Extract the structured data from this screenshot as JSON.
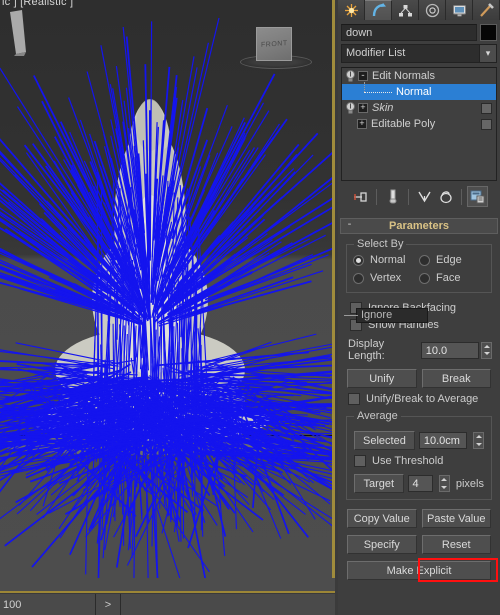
{
  "viewport": {
    "label": "ic ] [Realistic ]",
    "viewcube_face": "FRONT",
    "normals_color": "#1414ee",
    "mesh_color": "#dcdcd2",
    "background_color": "#454545",
    "active_border_color": "#a08c3c"
  },
  "timeline": {
    "frame_value": "100",
    "next_button": ">"
  },
  "command_panel": {
    "tabs": [
      {
        "name": "create-tab",
        "icon": "star-icon",
        "active": false
      },
      {
        "name": "modify-tab",
        "icon": "bent-arrow-icon",
        "active": true
      },
      {
        "name": "hierarchy-tab",
        "icon": "hierarchy-icon",
        "active": false
      },
      {
        "name": "motion-tab",
        "icon": "wheel-icon",
        "active": false
      },
      {
        "name": "display-tab",
        "icon": "monitor-icon",
        "active": false
      },
      {
        "name": "utilities-tab",
        "icon": "hammer-icon",
        "active": false
      }
    ],
    "object_name": "down",
    "object_color": "#060606",
    "modifier_list_label": "Modifier List",
    "stack": [
      {
        "label": "Edit Normals",
        "bulb": true,
        "expand": "-",
        "selected": false,
        "italic": false,
        "checkbox": false,
        "indent": false
      },
      {
        "label": "Normal",
        "bulb": false,
        "expand": "",
        "selected": true,
        "italic": false,
        "checkbox": false,
        "indent": true
      },
      {
        "label": "Skin",
        "bulb": true,
        "expand": "+",
        "selected": false,
        "italic": true,
        "checkbox": true,
        "indent": false
      },
      {
        "label": "Editable Poly",
        "bulb": false,
        "expand": "+",
        "selected": false,
        "italic": false,
        "checkbox": true,
        "indent": false
      }
    ],
    "stack_toolbar": [
      {
        "name": "pin-stack-icon",
        "framed": false
      },
      {
        "name": "show-end-result-icon",
        "framed": false
      },
      {
        "name": "make-unique-icon",
        "framed": false
      },
      {
        "name": "remove-modifier-icon",
        "framed": false
      },
      {
        "name": "configure-modifier-sets-icon",
        "framed": true
      }
    ]
  },
  "parameters": {
    "rollout_title": "Parameters",
    "collapse_glyph": "-",
    "select_by": {
      "title": "Select By",
      "options": [
        {
          "label": "Normal",
          "selected": true
        },
        {
          "label": "Edge",
          "selected": false
        },
        {
          "label": "Vertex",
          "selected": false
        },
        {
          "label": "Face",
          "selected": false
        }
      ]
    },
    "tooltip_text": "Ignore",
    "ignore_backfacing": {
      "label": "Ignore Backfacing",
      "checked": false
    },
    "show_handles": {
      "label": "Show Handles",
      "checked": false
    },
    "display_length": {
      "label": "Display Length:",
      "value": "10.0"
    },
    "unify_button": "Unify",
    "break_button": "Break",
    "unify_break_to_average": {
      "label": "Unify/Break to Average",
      "checked": false
    },
    "average": {
      "title": "Average",
      "selected_button": "Selected",
      "selected_value": "10.0cm",
      "use_threshold": {
        "label": "Use Threshold",
        "checked": false
      },
      "target_button": "Target",
      "target_value": "4",
      "target_units": "pixels"
    },
    "copy_value_button": "Copy Value",
    "paste_value_button": "Paste Value",
    "specify_button": "Specify",
    "reset_button": "Reset",
    "make_explicit_button": "Make Explicit",
    "highlight_color": "#ff1010"
  }
}
